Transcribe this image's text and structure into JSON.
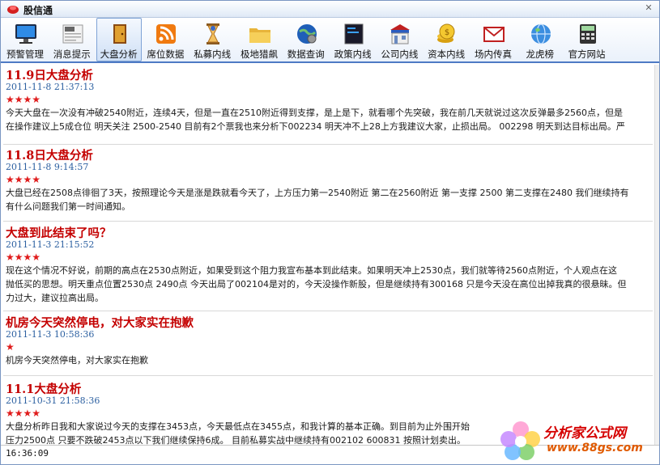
{
  "app": {
    "title": "股信通"
  },
  "toolbar": {
    "items": [
      {
        "label": "预警管理",
        "icon": "monitor-icon"
      },
      {
        "label": "消息提示",
        "icon": "newspaper-icon"
      },
      {
        "label": "大盘分析",
        "icon": "door-icon",
        "active": true
      },
      {
        "label": "席位数据",
        "icon": "rss-icon"
      },
      {
        "label": "私募内线",
        "icon": "hourglass-icon"
      },
      {
        "label": "极地猎飙",
        "icon": "folder-icon"
      },
      {
        "label": "数据查询",
        "icon": "globe-gear-icon"
      },
      {
        "label": "政策内线",
        "icon": "terminal-icon"
      },
      {
        "label": "公司内线",
        "icon": "store-icon"
      },
      {
        "label": "资本内线",
        "icon": "coins-icon"
      },
      {
        "label": "场内传真",
        "icon": "mail-icon"
      },
      {
        "label": "龙虎榜",
        "icon": "globe-icon"
      },
      {
        "label": "官方网站",
        "icon": "calculator-icon"
      }
    ]
  },
  "posts": [
    {
      "title": "11.9日大盘分析",
      "date": "2011-11-8 21:37:13",
      "stars": "★★★★",
      "lines": [
        "今天大盘在一次没有冲破2540附近，连续4天，但是一直在2510附近得到支撑，是上是下，就看哪个先突破，我在前几天就说过这次反弹最多2560点，但是",
        "在操作建议上5成仓位  明天关注  2500-2540 目前有2个票我也来分析下002234 明天冲不上28上方我建议大家，止损出局。  002298 明天到达目标出局。严"
      ]
    },
    {
      "title": "11.8日大盘分析",
      "date": "2011-11-8 9:14:57",
      "stars": "★★★★",
      "lines": [
        "大盘已经在2508点徘徊了3天，按照理论今天是涨是跌就看今天了，上方压力第一2540附近  第二在2560附近  第一支撑  2500 第二支撑在2480 我们继续持有",
        "有什么问题我们第一时间通知。"
      ]
    },
    {
      "title": "大盘到此结束了吗？",
      "date": "2011-11-3 21:15:52",
      "stars": "★★★★",
      "lines": [
        "现在这个情况不好说，前期的高点在2530点附近，如果受到这个阻力我宣布基本到此结束。如果明天冲上2530点，我们就等待2560点附近，个人观点在这",
        "抛低买的思想。明天重点位置2530点  2490点  今天出局了002104是对的，今天没操作新股，但是继续持有300168 只是今天没在高位出掉我真的很悬昧。但",
        "力过大，建议拉高出局。"
      ]
    },
    {
      "title": "机房今天突然停电，对大家实在抱歉",
      "date": "2011-11-3 10:58:36",
      "stars": "★",
      "lines": [
        "机房今天突然停电，对大家实在抱歉"
      ]
    },
    {
      "title": "11.1大盘分析",
      "date": "2011-10-31 21:58:36",
      "stars": "★★★★",
      "lines": [
        "大盘分析昨日我和大家说过今天的支撑在3453点，今天最低点在3455点，和我计算的基本正确。到目前为止外围开始",
        "压力2500点  只要不跌破2453点以下我们继续保持6成。  目前私募实战中继续持有002102 600831 按照计划卖出。"
      ]
    }
  ],
  "status": {
    "time": "16:36:09"
  },
  "watermark": {
    "text": "分析家公式网",
    "url": "www.88gs.com"
  }
}
